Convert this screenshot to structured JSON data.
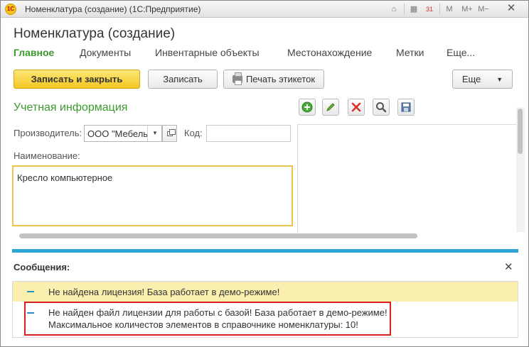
{
  "window": {
    "title": "Номенклатура (создание)  (1С:Предприятие)",
    "logo_text": "1С",
    "memory_buttons": [
      "M",
      "M+",
      "M−"
    ],
    "calendar_day": "31"
  },
  "form": {
    "title": "Номенклатура (создание)",
    "tabs": [
      {
        "label": "Главное"
      },
      {
        "label": "Документы"
      },
      {
        "label": "Инвентарные объекты"
      },
      {
        "label": "Местонахождение"
      },
      {
        "label": "Метки"
      },
      {
        "label": "Еще..."
      }
    ]
  },
  "toolbar": {
    "save_close_label": "Записать и закрыть",
    "save_label": "Записать",
    "print_labels_label": "Печать этикеток",
    "more_label": "Еще"
  },
  "section": {
    "title": "Учетная информация",
    "icons": [
      "add-icon",
      "edit-icon",
      "delete-icon",
      "search-icon",
      "save-icon"
    ]
  },
  "fields": {
    "manufacturer_label": "Производитель:",
    "manufacturer_value": "ООО \"Мебель",
    "code_label": "Код:",
    "code_value": "",
    "name_label": "Наименование:",
    "name_value": "Кресло компьютерное"
  },
  "messages": {
    "title": "Сообщения:",
    "items": [
      {
        "text": "Не найдена лицензия! База работает в демо-режиме!"
      },
      {
        "line1": "Не найден файл лицензии для работы с базой! База работает в демо-режиме!",
        "line2": "Максимальное количестов элементов в справочнике номенклатуры: 10!"
      }
    ]
  },
  "colors": {
    "accent_green": "#3c9a2f",
    "primary_button": "#f3c622",
    "message_bar": "#2aa6d6",
    "highlight_row": "#fbefb0",
    "error_box": "#d82020"
  }
}
